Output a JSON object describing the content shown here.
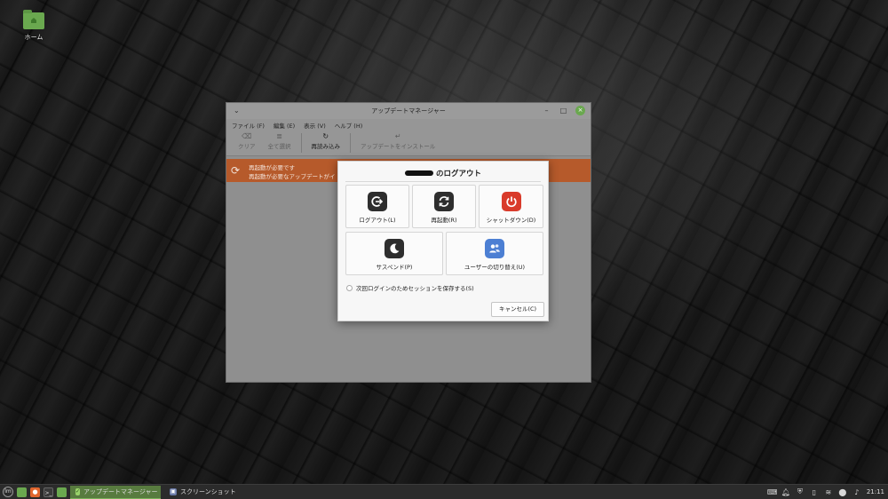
{
  "desktop": {
    "icons": [
      {
        "label": "ホーム",
        "icon": "home-folder-icon"
      }
    ]
  },
  "update_manager": {
    "title": "アップデートマネージャー",
    "menu": [
      "ファイル (F)",
      "編集 (E)",
      "表示 (V)",
      "ヘルプ (H)"
    ],
    "toolbar": {
      "clear": "クリア",
      "select_all": "全て選択",
      "refresh": "再読み込み",
      "install": "アップデートをインストール"
    },
    "banner": {
      "title": "再起動が必要です",
      "message": "再起動が必要なアップデートがイ"
    },
    "colors": {
      "banner": "#b65a2b",
      "close": "#6aa84f"
    }
  },
  "logout_dialog": {
    "title_suffix": "のログアウト",
    "buttons": {
      "logout": "ログアウト(L)",
      "restart": "再起動(R)",
      "shutdown": "シャットダウン(D)",
      "suspend": "サスペンド(P)",
      "switch_user": "ユーザーの切り替え(U)"
    },
    "save_session_label": "次回ログインのためセッションを保存する(S)",
    "save_session_checked": false,
    "cancel": "キャンセル(C)",
    "colors": {
      "shutdown": "#d93b2b",
      "switch_user": "#4c7fd3",
      "dark_icon": "#2e2e2e"
    }
  },
  "taskbar": {
    "apps": [
      {
        "label": "アップデートマネージャー",
        "active": true
      },
      {
        "label": "スクリーンショット",
        "active": false
      }
    ],
    "clock": "21:11",
    "tray_icons": [
      "keyboard-icon",
      "notification-bell-icon",
      "shield-icon",
      "clipboard-icon",
      "network-wifi-icon",
      "update-icon",
      "volume-icon"
    ]
  }
}
